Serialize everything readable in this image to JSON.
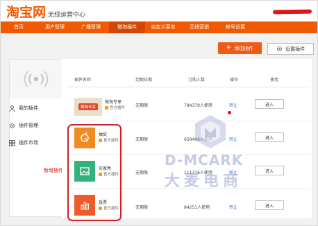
{
  "header": {
    "logo": "淘宝网",
    "subtitle": "无线运营中心"
  },
  "nav": [
    {
      "label": "首页",
      "active": false
    },
    {
      "label": "用户管理",
      "active": false
    },
    {
      "label": "广播管理",
      "active": false
    },
    {
      "label": "微淘插件",
      "active": true
    },
    {
      "label": "自定义菜单",
      "active": false
    },
    {
      "label": "无线营销",
      "active": false
    },
    {
      "label": "帐号设置",
      "active": false
    }
  ],
  "actions": {
    "add": "添加插件",
    "settings": "设置插件"
  },
  "sidebar": {
    "items": [
      {
        "label": "我的插件",
        "icon": "user-icon"
      },
      {
        "label": "插件管理",
        "icon": "gear-icon"
      },
      {
        "label": "插件市场",
        "icon": "grid-icon"
      }
    ]
  },
  "annotation": "新增插件",
  "table": {
    "headers": [
      "插件名称",
      "到期日期",
      "订购人数",
      "操作",
      "使用"
    ],
    "rows": [
      {
        "name": "微淘专享",
        "sub": "官方插件",
        "thumb_text": "微淘专享",
        "expiry": "无期限",
        "users": "784379人使用",
        "op": "转让",
        "use": "进入",
        "thumb_color": "#e9dfc9"
      },
      {
        "name": "抽奖",
        "sub": "官方插件",
        "thumb_text": "",
        "expiry": "无期限",
        "users": "658466人使用",
        "op": "转让",
        "use": "进入",
        "thumb_color": "#f08a22"
      },
      {
        "name": "买家秀",
        "sub": "官方插件",
        "thumb_text": "",
        "expiry": "无期限",
        "users": "111316人使用",
        "op": "转让",
        "use": "进入",
        "thumb_color": "#34b27b"
      },
      {
        "name": "投票",
        "sub": "官方插件",
        "thumb_text": "",
        "expiry": "无期限",
        "users": "84251人使用",
        "op": "转让",
        "use": "进入",
        "thumb_color": "#ef5a2a"
      }
    ]
  },
  "watermark": {
    "en": "D-MCARK",
    "cn": "大麦电商"
  }
}
